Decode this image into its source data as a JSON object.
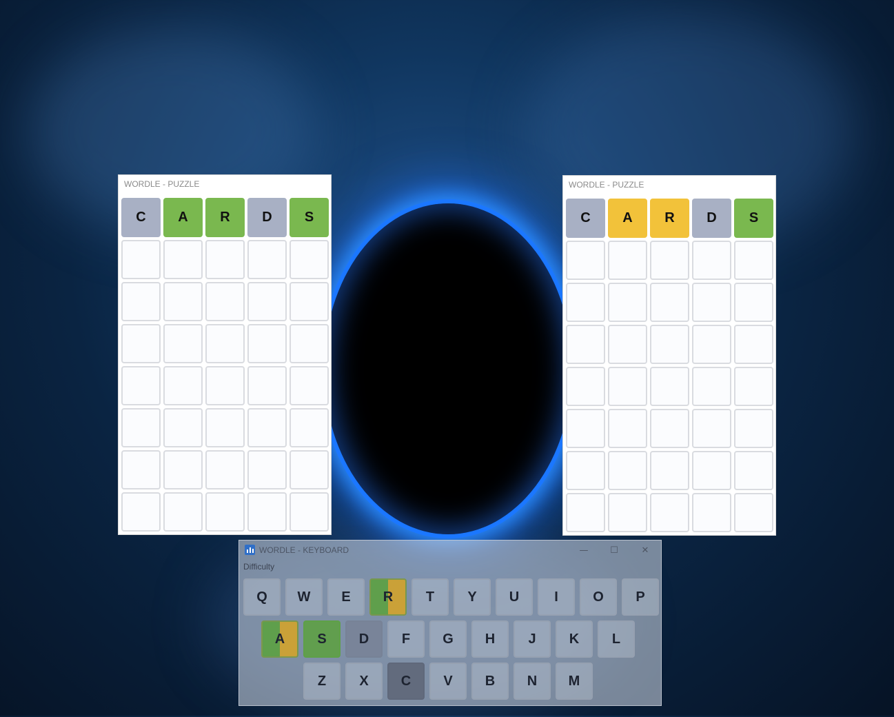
{
  "left_puzzle": {
    "title": "WORDLE - PUZZLE",
    "guess": [
      {
        "letter": "C",
        "state": "gray"
      },
      {
        "letter": "A",
        "state": "green"
      },
      {
        "letter": "R",
        "state": "green"
      },
      {
        "letter": "D",
        "state": "gray"
      },
      {
        "letter": "S",
        "state": "green"
      }
    ]
  },
  "right_puzzle": {
    "title": "WORDLE - PUZZLE",
    "guess": [
      {
        "letter": "C",
        "state": "gray"
      },
      {
        "letter": "A",
        "state": "yellow"
      },
      {
        "letter": "R",
        "state": "yellow"
      },
      {
        "letter": "D",
        "state": "gray"
      },
      {
        "letter": "S",
        "state": "green"
      }
    ]
  },
  "keyboard": {
    "title": "WORDLE - KEYBOARD",
    "menu": "Difficulty",
    "window_buttons": {
      "minimize": "—",
      "maximize": "☐",
      "close": "✕"
    },
    "rows": [
      [
        {
          "key": "Q",
          "state": ""
        },
        {
          "key": "W",
          "state": ""
        },
        {
          "key": "E",
          "state": ""
        },
        {
          "key": "R",
          "state": "split"
        },
        {
          "key": "T",
          "state": ""
        },
        {
          "key": "Y",
          "state": ""
        },
        {
          "key": "U",
          "state": ""
        },
        {
          "key": "I",
          "state": ""
        },
        {
          "key": "O",
          "state": ""
        },
        {
          "key": "P",
          "state": ""
        }
      ],
      [
        {
          "key": "A",
          "state": "split"
        },
        {
          "key": "S",
          "state": "green"
        },
        {
          "key": "D",
          "state": "gray"
        },
        {
          "key": "F",
          "state": ""
        },
        {
          "key": "G",
          "state": ""
        },
        {
          "key": "H",
          "state": ""
        },
        {
          "key": "J",
          "state": ""
        },
        {
          "key": "K",
          "state": ""
        },
        {
          "key": "L",
          "state": ""
        }
      ],
      [
        {
          "key": "Z",
          "state": ""
        },
        {
          "key": "X",
          "state": ""
        },
        {
          "key": "C",
          "state": "dark"
        },
        {
          "key": "V",
          "state": ""
        },
        {
          "key": "B",
          "state": ""
        },
        {
          "key": "N",
          "state": ""
        },
        {
          "key": "M",
          "state": ""
        }
      ]
    ]
  },
  "colors": {
    "green": "#7ab84f",
    "yellow": "#f2c23a",
    "gray": "#a8b0c4"
  }
}
